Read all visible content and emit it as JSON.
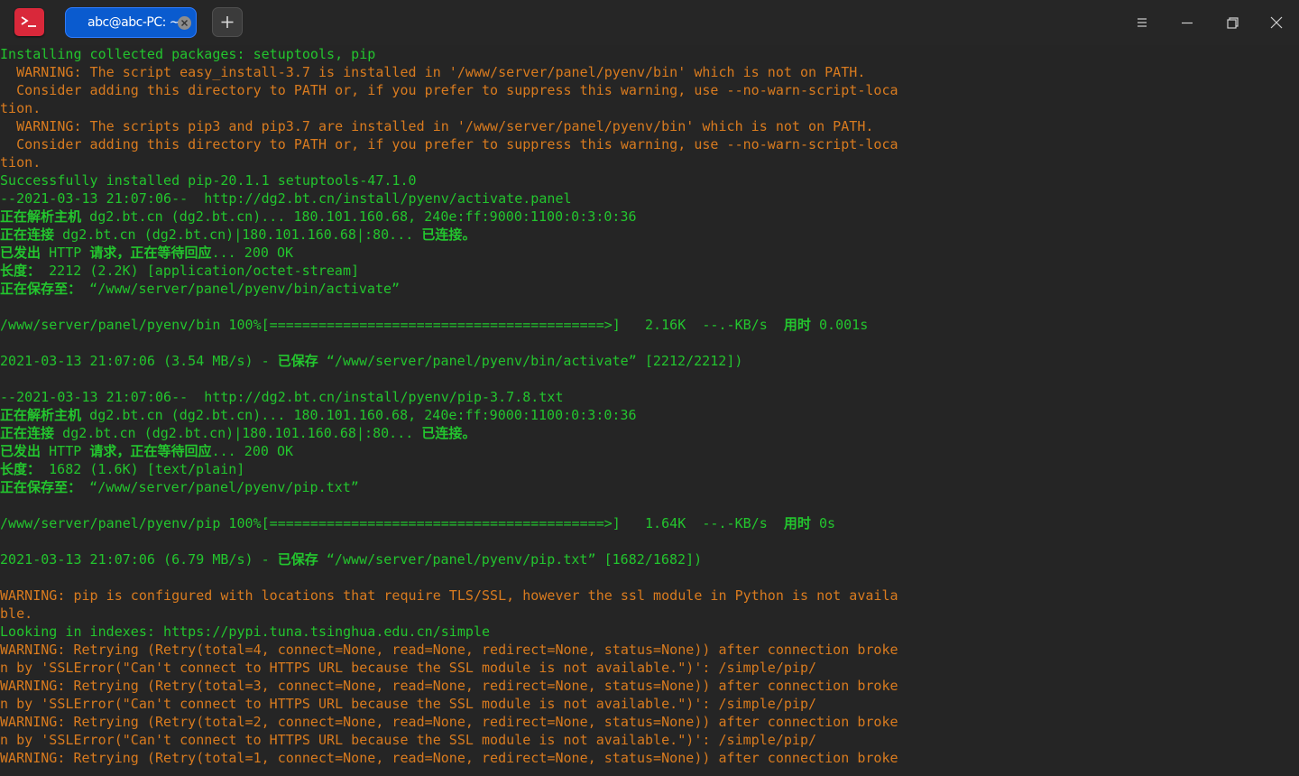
{
  "window": {
    "tab_title": "abc@abc-PC: ~"
  },
  "colors": {
    "background": "#252525",
    "green_text": "#23c52e",
    "orange_text": "#d97b1f",
    "tab_active": "#0a5bcf",
    "app_icon": "#d9283a"
  },
  "icons": {
    "app": "terminal-prompt-icon",
    "tab_close": "close-circle-icon",
    "new_tab": "plus-icon",
    "menu": "hamburger-menu-icon",
    "minimize": "minimize-icon",
    "maximize": "maximize-icon",
    "close": "close-icon"
  },
  "lines": [
    {
      "segs": [
        {
          "t": "Installing collected packages: setuptools, pip",
          "c": "g"
        }
      ]
    },
    {
      "segs": [
        {
          "t": "  WARNING: The script easy_install-3.7 is installed in '/www/server/panel/pyenv/bin' which is not on PATH.",
          "c": "o"
        }
      ]
    },
    {
      "segs": [
        {
          "t": "  Consider adding this directory to PATH or, if you prefer to suppress this warning, use --no-warn-script-loca",
          "c": "o"
        }
      ]
    },
    {
      "segs": [
        {
          "t": "tion.",
          "c": "o"
        }
      ]
    },
    {
      "segs": [
        {
          "t": "  WARNING: The scripts pip3 and pip3.7 are installed in '/www/server/panel/pyenv/bin' which is not on PATH.",
          "c": "o"
        }
      ]
    },
    {
      "segs": [
        {
          "t": "  Consider adding this directory to PATH or, if you prefer to suppress this warning, use --no-warn-script-loca",
          "c": "o"
        }
      ]
    },
    {
      "segs": [
        {
          "t": "tion.",
          "c": "o"
        }
      ]
    },
    {
      "segs": [
        {
          "t": "Successfully installed pip-20.1.1 setuptools-47.1.0",
          "c": "g"
        }
      ]
    },
    {
      "segs": [
        {
          "t": "--2021-03-13 21:07:06--  http://dg2.bt.cn/install/pyenv/activate.panel",
          "c": "g"
        }
      ]
    },
    {
      "segs": [
        {
          "t": "正在解析主机",
          "c": "g",
          "b": true
        },
        {
          "t": " dg2.bt.cn (dg2.bt.cn)... 180.101.160.68, 240e:ff:9000:1100:0:3:0:36",
          "c": "g"
        }
      ]
    },
    {
      "segs": [
        {
          "t": "正在连接",
          "c": "g",
          "b": true
        },
        {
          "t": " dg2.bt.cn (dg2.bt.cn)|180.101.160.68|:80... ",
          "c": "g"
        },
        {
          "t": "已连接。",
          "c": "g",
          "b": true
        }
      ]
    },
    {
      "segs": [
        {
          "t": "已发出",
          "c": "g",
          "b": true
        },
        {
          "t": " HTTP ",
          "c": "g"
        },
        {
          "t": "请求，正在等待回应",
          "c": "g",
          "b": true
        },
        {
          "t": "... 200 OK",
          "c": "g"
        }
      ]
    },
    {
      "segs": [
        {
          "t": "长度：",
          "c": "g",
          "b": true
        },
        {
          "t": " 2212 (2.2K) [application/octet-stream]",
          "c": "g"
        }
      ]
    },
    {
      "segs": [
        {
          "t": "正在保存至：",
          "c": "g",
          "b": true
        },
        {
          "t": " “/www/server/panel/pyenv/bin/activate”",
          "c": "g"
        }
      ]
    },
    {
      "segs": [
        {
          "t": "",
          "c": "g"
        }
      ]
    },
    {
      "segs": [
        {
          "t": "/www/server/panel/pyenv/bin 100%[=========================================>]   2.16K  --.-KB/s  ",
          "c": "g"
        },
        {
          "t": "用时",
          "c": "g",
          "b": true
        },
        {
          "t": " 0.001s",
          "c": "g"
        }
      ]
    },
    {
      "segs": [
        {
          "t": "",
          "c": "g"
        }
      ]
    },
    {
      "segs": [
        {
          "t": "2021-03-13 21:07:06 (3.54 MB/s) - ",
          "c": "g"
        },
        {
          "t": "已保存",
          "c": "g",
          "b": true
        },
        {
          "t": " “/www/server/panel/pyenv/bin/activate” [2212/2212])",
          "c": "g"
        }
      ]
    },
    {
      "segs": [
        {
          "t": "",
          "c": "g"
        }
      ]
    },
    {
      "segs": [
        {
          "t": "--2021-03-13 21:07:06--  http://dg2.bt.cn/install/pyenv/pip-3.7.8.txt",
          "c": "g"
        }
      ]
    },
    {
      "segs": [
        {
          "t": "正在解析主机",
          "c": "g",
          "b": true
        },
        {
          "t": " dg2.bt.cn (dg2.bt.cn)... 180.101.160.68, 240e:ff:9000:1100:0:3:0:36",
          "c": "g"
        }
      ]
    },
    {
      "segs": [
        {
          "t": "正在连接",
          "c": "g",
          "b": true
        },
        {
          "t": " dg2.bt.cn (dg2.bt.cn)|180.101.160.68|:80... ",
          "c": "g"
        },
        {
          "t": "已连接。",
          "c": "g",
          "b": true
        }
      ]
    },
    {
      "segs": [
        {
          "t": "已发出",
          "c": "g",
          "b": true
        },
        {
          "t": " HTTP ",
          "c": "g"
        },
        {
          "t": "请求，正在等待回应",
          "c": "g",
          "b": true
        },
        {
          "t": "... 200 OK",
          "c": "g"
        }
      ]
    },
    {
      "segs": [
        {
          "t": "长度：",
          "c": "g",
          "b": true
        },
        {
          "t": " 1682 (1.6K) [text/plain]",
          "c": "g"
        }
      ]
    },
    {
      "segs": [
        {
          "t": "正在保存至：",
          "c": "g",
          "b": true
        },
        {
          "t": " “/www/server/panel/pyenv/pip.txt”",
          "c": "g"
        }
      ]
    },
    {
      "segs": [
        {
          "t": "",
          "c": "g"
        }
      ]
    },
    {
      "segs": [
        {
          "t": "/www/server/panel/pyenv/pip 100%[=========================================>]   1.64K  --.-KB/s  ",
          "c": "g"
        },
        {
          "t": "用时",
          "c": "g",
          "b": true
        },
        {
          "t": " 0s",
          "c": "g"
        }
      ]
    },
    {
      "segs": [
        {
          "t": "",
          "c": "g"
        }
      ]
    },
    {
      "segs": [
        {
          "t": "2021-03-13 21:07:06 (6.79 MB/s) - ",
          "c": "g"
        },
        {
          "t": "已保存",
          "c": "g",
          "b": true
        },
        {
          "t": " “/www/server/panel/pyenv/pip.txt” [1682/1682])",
          "c": "g"
        }
      ]
    },
    {
      "segs": [
        {
          "t": "",
          "c": "g"
        }
      ]
    },
    {
      "segs": [
        {
          "t": "WARNING: pip is configured with locations that require TLS/SSL, however the ssl module in Python is not availa",
          "c": "o"
        }
      ]
    },
    {
      "segs": [
        {
          "t": "ble.",
          "c": "o"
        }
      ]
    },
    {
      "segs": [
        {
          "t": "Looking in indexes: https://pypi.tuna.tsinghua.edu.cn/simple",
          "c": "g"
        }
      ]
    },
    {
      "segs": [
        {
          "t": "WARNING: Retrying (Retry(total=4, connect=None, read=None, redirect=None, status=None)) after connection broke",
          "c": "o"
        }
      ]
    },
    {
      "segs": [
        {
          "t": "n by 'SSLError(\"Can't connect to HTTPS URL because the SSL module is not available.\")': /simple/pip/",
          "c": "o"
        }
      ]
    },
    {
      "segs": [
        {
          "t": "WARNING: Retrying (Retry(total=3, connect=None, read=None, redirect=None, status=None)) after connection broke",
          "c": "o"
        }
      ]
    },
    {
      "segs": [
        {
          "t": "n by 'SSLError(\"Can't connect to HTTPS URL because the SSL module is not available.\")': /simple/pip/",
          "c": "o"
        }
      ]
    },
    {
      "segs": [
        {
          "t": "WARNING: Retrying (Retry(total=2, connect=None, read=None, redirect=None, status=None)) after connection broke",
          "c": "o"
        }
      ]
    },
    {
      "segs": [
        {
          "t": "n by 'SSLError(\"Can't connect to HTTPS URL because the SSL module is not available.\")': /simple/pip/",
          "c": "o"
        }
      ]
    },
    {
      "segs": [
        {
          "t": "WARNING: Retrying (Retry(total=1, connect=None, read=None, redirect=None, status=None)) after connection broke",
          "c": "o"
        }
      ]
    }
  ]
}
